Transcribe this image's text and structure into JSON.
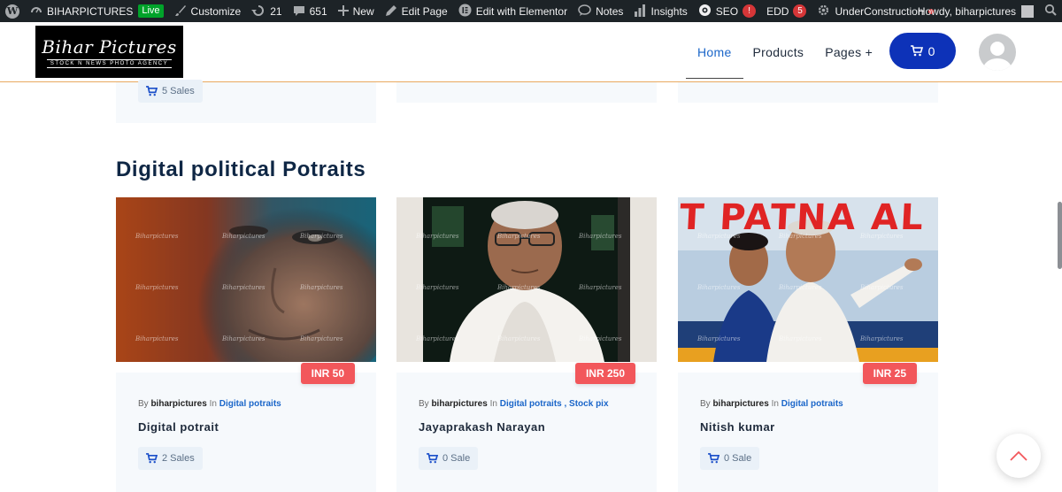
{
  "adminbar": {
    "site_name": "BIHARPICTURES",
    "live_badge": "Live",
    "customize": "Customize",
    "updates_count": "21",
    "comments_count": "651",
    "new": "New",
    "edit_page": "Edit Page",
    "edit_elementor": "Edit with Elementor",
    "notes": "Notes",
    "insights": "Insights",
    "seo": "SEO",
    "seo_badge": "!",
    "edd": "EDD",
    "edd_badge": "5",
    "under_construction": "UnderConstruction",
    "howdy": "Howdy, biharpictures"
  },
  "header": {
    "logo_main": "Bihar Pictures",
    "logo_sub": "STOCK N NEWS PHOTO AGENCY",
    "nav": [
      {
        "label": "Home"
      },
      {
        "label": "Products"
      },
      {
        "label": "Pages +"
      }
    ],
    "cart_count": "0"
  },
  "previous_row": {
    "sales_label": "5 Sales"
  },
  "section": {
    "title": "Digital political Potraits"
  },
  "products": [
    {
      "price": "INR 50",
      "by": "By",
      "author": "biharpictures",
      "in": "In",
      "categories": "Digital potraits",
      "title": "Digital potrait",
      "sales": "2 Sales"
    },
    {
      "price": "INR 250",
      "by": "By",
      "author": "biharpictures",
      "in": "In",
      "categories": "Digital potraits , Stock pix",
      "title": "Jayaprakash Narayan",
      "sales": "0 Sale"
    },
    {
      "price": "INR 25",
      "by": "By",
      "author": "biharpictures",
      "in": "In",
      "categories": "Digital potraits",
      "title": "Nitish kumar",
      "sales": "0 Sale"
    }
  ],
  "watermark": "Biharpictures",
  "banner_text": "T PATNA AL",
  "colors": {
    "accent": "#0d32b8",
    "price": "#f2575b",
    "link": "#1b66c9",
    "title": "#0f2745"
  }
}
